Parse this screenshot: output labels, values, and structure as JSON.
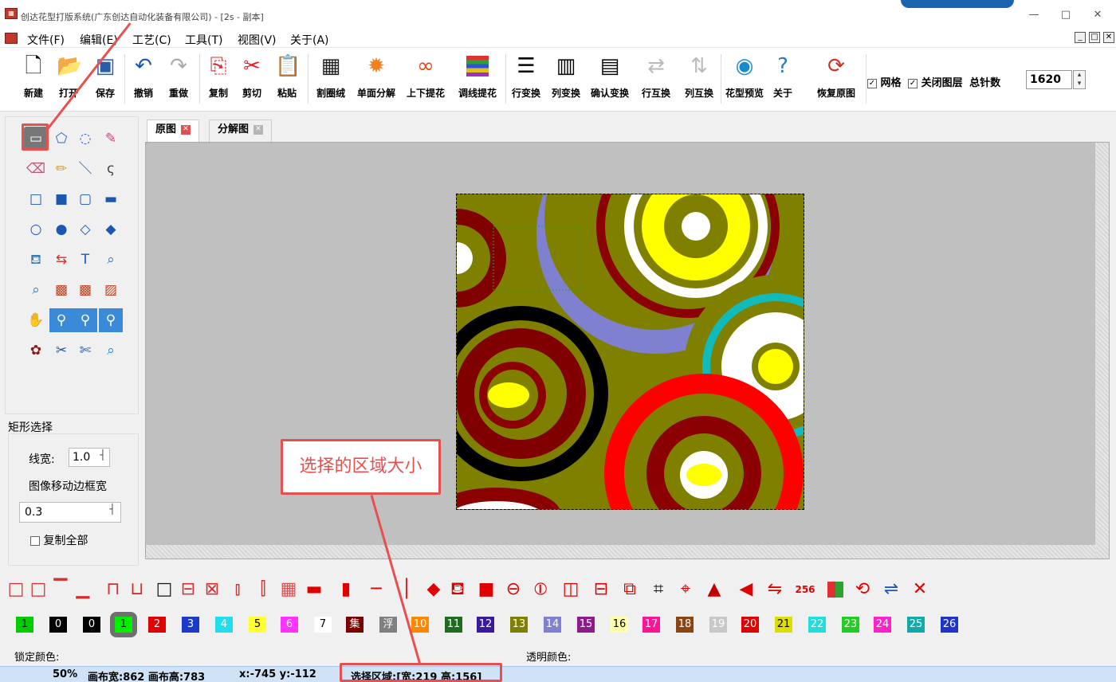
{
  "window": {
    "title": "创达花型打版系统(广东创达自动化装备有限公司) - [2s - 副本]",
    "controls": [
      "—",
      "□",
      "✕"
    ]
  },
  "menu": {
    "items": [
      "文件(F)",
      "编辑(E)",
      "工艺(C)",
      "工具(T)",
      "视图(V)",
      "关于(A)"
    ],
    "mdi_controls": [
      "_",
      "□",
      "✕"
    ]
  },
  "toolbar": {
    "buttons": [
      {
        "label": "新建",
        "icon": "new-file-icon"
      },
      {
        "label": "打开",
        "icon": "open-folder-icon"
      },
      {
        "label": "保存",
        "icon": "save-icon"
      },
      {
        "label": "撤销",
        "icon": "undo-icon"
      },
      {
        "label": "重做",
        "icon": "redo-icon"
      },
      {
        "label": "复制",
        "icon": "copy-icon"
      },
      {
        "label": "剪切",
        "icon": "scissors-icon"
      },
      {
        "label": "粘贴",
        "icon": "paste-icon"
      },
      {
        "label": "割圈绒",
        "icon": "loop-pile-icon"
      },
      {
        "label": "单面分解",
        "icon": "gear-icon"
      },
      {
        "label": "上下提花",
        "icon": "jacquard-icon"
      },
      {
        "label": "调线提花",
        "icon": "color-lines-icon"
      },
      {
        "label": "行变换",
        "icon": "row-transform-icon"
      },
      {
        "label": "列变换",
        "icon": "column-transform-icon"
      },
      {
        "label": "确认变换",
        "icon": "confirm-transform-icon"
      },
      {
        "label": "行互换",
        "icon": "row-swap-icon"
      },
      {
        "label": "列互换",
        "icon": "column-swap-icon"
      },
      {
        "label": "花型预览",
        "icon": "eye-icon"
      },
      {
        "label": "关于",
        "icon": "help-icon"
      },
      {
        "label": "恢复原图",
        "icon": "restore-icon"
      }
    ],
    "grid_label": "网格",
    "grid_checked": true,
    "close_layer_label": "关闭图层",
    "close_layer_checked": true,
    "total_needles_label": "总针数",
    "total_needles_value": "1620"
  },
  "tool_panel": {
    "selected_tool": "rect-select",
    "title": "矩形选择",
    "line_width_label": "线宽:",
    "line_width_value": "1.0",
    "move_border_label": "图像移动边框宽",
    "move_border_value": "0.3",
    "copy_all_label": "复制全部",
    "copy_all_checked": false
  },
  "tabs": [
    {
      "label": "原图",
      "active": true,
      "close_color": "#e05050"
    },
    {
      "label": "分解图",
      "active": false,
      "close_color": "#b5b5b5"
    }
  ],
  "annotation": {
    "callout_text": "选择的区域大小",
    "color": "#e8504f"
  },
  "colors": [
    {
      "label": "1",
      "bg": "#00cc00",
      "fg": "#000"
    },
    {
      "label": "0",
      "bg": "#000000",
      "fg": "#fff"
    },
    {
      "label": "0",
      "bg": "#000000",
      "fg": "#fff"
    },
    {
      "label": "1",
      "bg": "#00ee00",
      "fg": "#000",
      "selected": true
    },
    {
      "label": "2",
      "bg": "#e00000",
      "fg": "#fff"
    },
    {
      "label": "3",
      "bg": "#1a3cc8",
      "fg": "#fff"
    },
    {
      "label": "4",
      "bg": "#22ddee",
      "fg": "#fff"
    },
    {
      "label": "5",
      "bg": "#ffff33",
      "fg": "#000"
    },
    {
      "label": "6",
      "bg": "#ff33ff",
      "fg": "#fff"
    },
    {
      "label": "7",
      "bg": "#ffffff",
      "fg": "#000"
    },
    {
      "label": "集",
      "bg": "#7a0000",
      "fg": "#fff"
    },
    {
      "label": "浮",
      "bg": "#808080",
      "fg": "#fff"
    },
    {
      "label": "10",
      "bg": "#ff8800",
      "fg": "#fff"
    },
    {
      "label": "11",
      "bg": "#1f6b1f",
      "fg": "#fff"
    },
    {
      "label": "12",
      "bg": "#3a1a9a",
      "fg": "#fff"
    },
    {
      "label": "13",
      "bg": "#808000",
      "fg": "#fff"
    },
    {
      "label": "14",
      "bg": "#8080d0",
      "fg": "#fff"
    },
    {
      "label": "15",
      "bg": "#8b1a8b",
      "fg": "#fff"
    },
    {
      "label": "16",
      "bg": "#ffffaa",
      "fg": "#000"
    },
    {
      "label": "17",
      "bg": "#ff1493",
      "fg": "#fff"
    },
    {
      "label": "18",
      "bg": "#8b4513",
      "fg": "#fff"
    },
    {
      "label": "19",
      "bg": "#c8c8c8",
      "fg": "#fff"
    },
    {
      "label": "20",
      "bg": "#e00000",
      "fg": "#fff"
    },
    {
      "label": "21",
      "bg": "#dddd00",
      "fg": "#000"
    },
    {
      "label": "22",
      "bg": "#22dddd",
      "fg": "#fff"
    },
    {
      "label": "23",
      "bg": "#22cc22",
      "fg": "#fff"
    },
    {
      "label": "24",
      "bg": "#ff22cc",
      "fg": "#fff"
    },
    {
      "label": "25",
      "bg": "#11aaaa",
      "fg": "#fff"
    },
    {
      "label": "26",
      "bg": "#2233cc",
      "fg": "#fff"
    }
  ],
  "color_info": {
    "locked_label": "锁定颜色:",
    "transparent_label": "透明颜色:"
  },
  "status": {
    "zoom": "50%",
    "canvas_size": "画布宽:862 画布高:783",
    "cursor": "x:-745 y:-112",
    "selection": "选择区域:[宽:219 高:156]"
  }
}
